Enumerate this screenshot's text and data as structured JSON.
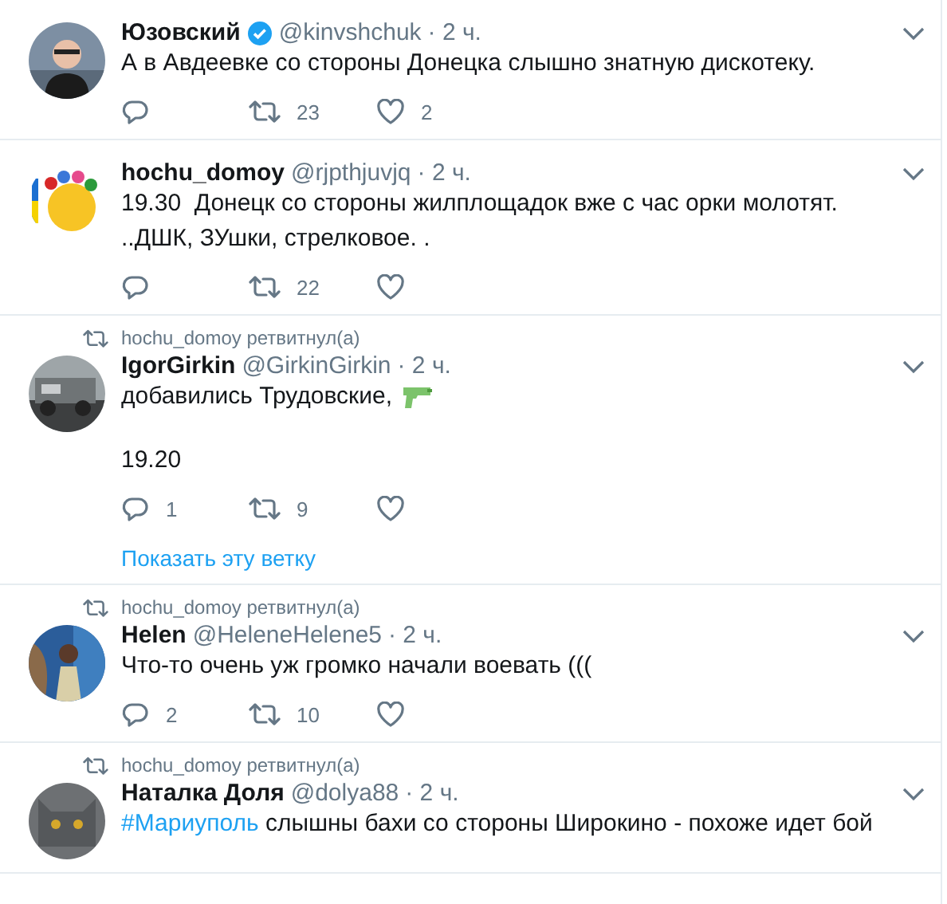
{
  "tweets": [
    {
      "name": "Юзовский",
      "verified": true,
      "handle": "@kinvshchuk",
      "time": "· 2 ч.",
      "paragraphs": [
        [
          {
            "kind": "text",
            "text": "А в Авдеевке со стороны Донецка слышно знатную дискотеку."
          }
        ]
      ],
      "retweets": "23",
      "likes": "2"
    },
    {
      "name": "hochu_domoy",
      "verified": false,
      "handle": "@rjpthjuvjq",
      "time": "· 2 ч.",
      "paragraphs": [
        [
          {
            "kind": "text",
            "text": "19.30  Донецк со стороны жилплощадок вже с час орки молотят. ..ДШК, ЗУшки, стрелковое. ."
          }
        ]
      ],
      "retweets": "22"
    },
    {
      "retweeted_by": "hochu_domoy ретвитнул(а)",
      "name": "IgorGirkin",
      "verified": false,
      "handle": "@GirkinGirkin",
      "time": "· 2 ч.",
      "paragraphs": [
        [
          {
            "kind": "text",
            "text": "добавились Трудовские,"
          },
          {
            "kind": "emoji"
          }
        ],
        [
          {
            "kind": "text",
            "text": "19.20"
          }
        ]
      ],
      "replies": "1",
      "retweets": "9",
      "thread_link": "Показать эту ветку"
    },
    {
      "retweeted_by": "hochu_domoy ретвитнул(а)",
      "name": "Helen",
      "verified": false,
      "handle": "@HeleneHelene5",
      "time": "· 2 ч.",
      "paragraphs": [
        [
          {
            "kind": "text",
            "text": "Что-то очень уж громко начали воевать ((("
          }
        ]
      ],
      "replies": "2",
      "retweets": "10"
    },
    {
      "retweeted_by": "hochu_domoy ретвитнул(а)",
      "name": "Наталка Доля",
      "verified": false,
      "handle": "@dolya88",
      "time": "· 2 ч.",
      "paragraphs": [
        [
          {
            "kind": "hashtag",
            "text": "#Мариуполь"
          },
          {
            "kind": "text",
            "text": " слышны бахи со стороны Широкино - похоже идет бой"
          }
        ]
      ]
    }
  ]
}
